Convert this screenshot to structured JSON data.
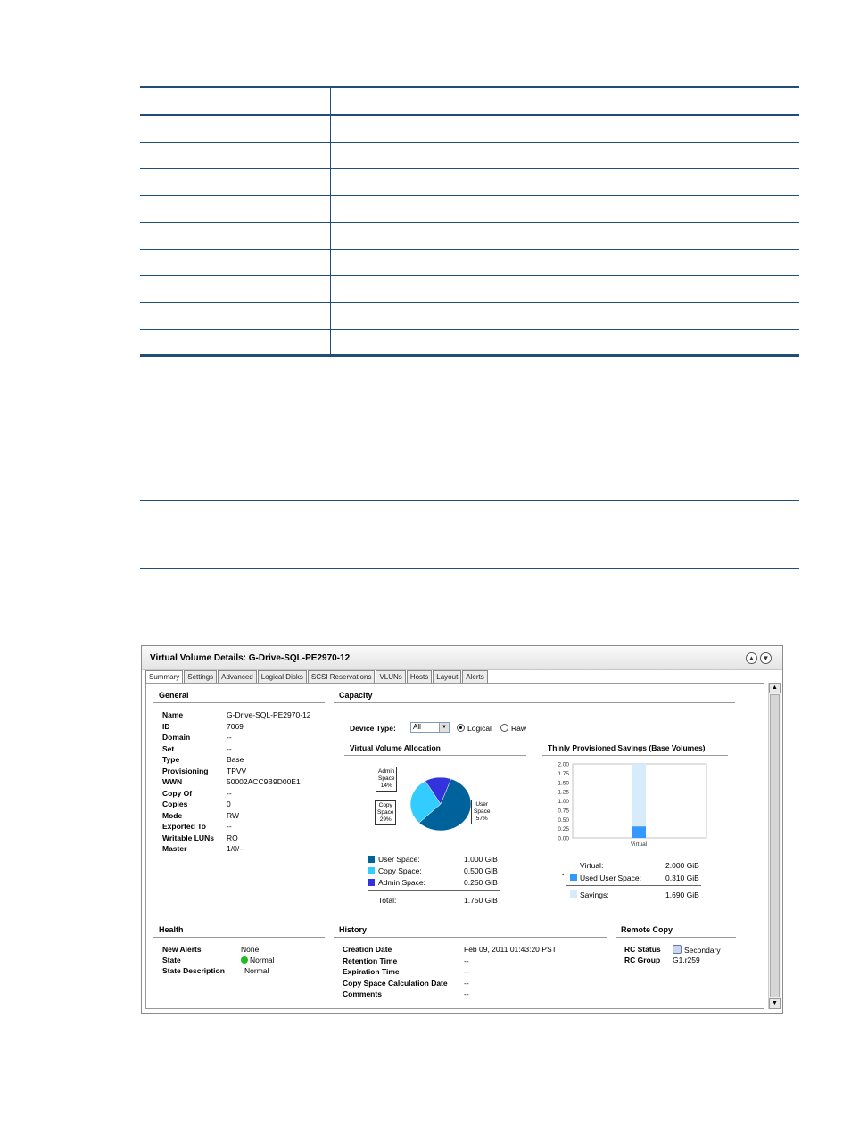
{
  "window": {
    "title": "Virtual Volume Details: G-Drive-SQL-PE2970-12",
    "tabs": [
      "Summary",
      "Settings",
      "Advanced",
      "Logical Disks",
      "SCSI Reservations",
      "VLUNs",
      "Hosts",
      "Layout",
      "Alerts"
    ],
    "active_tab": "Summary"
  },
  "general": {
    "title": "General",
    "fields": [
      {
        "label": "Name",
        "value": "G-Drive-SQL-PE2970-12"
      },
      {
        "label": "ID",
        "value": "7069"
      },
      {
        "label": "Domain",
        "value": "--"
      },
      {
        "label": "Set",
        "value": "--"
      },
      {
        "label": "Type",
        "value": "Base"
      },
      {
        "label": "Provisioning",
        "value": "TPVV"
      },
      {
        "label": "WWN",
        "value": "50002ACC9B9D00E1"
      },
      {
        "label": "Copy Of",
        "value": "--"
      },
      {
        "label": "Copies",
        "value": "0"
      },
      {
        "label": "Mode",
        "value": "RW"
      },
      {
        "label": "Exported To",
        "value": "--"
      },
      {
        "label": "Writable LUNs",
        "value": "RO"
      },
      {
        "label": "Master",
        "value": "1/0/--"
      }
    ]
  },
  "capacity": {
    "title": "Capacity",
    "device_type_label": "Device Type:",
    "device_type_value": "All",
    "radio_logical": "Logical",
    "radio_raw": "Raw",
    "allocation_title": "Virtual Volume Allocation",
    "savings_title": "Thinly Provisioned Savings (Base Volumes)",
    "legend": [
      {
        "label": "User Space:",
        "value": "1.000 GiB",
        "color": "#00629b"
      },
      {
        "label": "Copy Space:",
        "value": "0.500 GiB",
        "color": "#33ccff"
      },
      {
        "label": "Admin Space:",
        "value": "0.250 GiB",
        "color": "#3333dd"
      }
    ],
    "total_label": "Total:",
    "total_value": "1.750 GiB",
    "savings_rows": [
      {
        "label": "Virtual:",
        "value": "2.000 GiB"
      },
      {
        "label": "Used User Space:",
        "value": "0.310 GiB"
      },
      {
        "label": "Savings:",
        "value": "1.690 GiB"
      }
    ]
  },
  "chart_data": [
    {
      "type": "pie",
      "title": "Virtual Volume Allocation",
      "slices": [
        {
          "label": "User Space",
          "percent": 57,
          "color": "#00629b"
        },
        {
          "label": "Copy Space",
          "percent": 29,
          "color": "#33ccff"
        },
        {
          "label": "Admin Space",
          "percent": 14,
          "color": "#3333dd"
        }
      ],
      "callouts": [
        {
          "line1": "User",
          "line2": "Space",
          "line3": "57%"
        },
        {
          "line1": "Copy",
          "line2": "Space",
          "line3": "29%"
        },
        {
          "line1": "Admin",
          "line2": "Space",
          "line3": "14%"
        }
      ]
    },
    {
      "type": "bar",
      "title": "Thinly Provisioned Savings (Base Volumes)",
      "categories": [
        "Virtual"
      ],
      "stack": [
        {
          "name": "Used User Space",
          "value": 0.31,
          "color": "#3399ff"
        },
        {
          "name": "Savings",
          "value": 1.69,
          "color": "#d6ecfb"
        }
      ],
      "yticks": [
        "2.00",
        "1.75",
        "1.50",
        "1.25",
        "1.00",
        "0.75",
        "0.50",
        "0.25",
        "0.00"
      ],
      "ylim": [
        0,
        2
      ]
    }
  ],
  "health": {
    "title": "Health",
    "fields": [
      {
        "label": "New Alerts",
        "value": "None"
      },
      {
        "label": "State",
        "value": "Normal"
      },
      {
        "label": "State Description",
        "value": "Normal"
      }
    ],
    "status_color": "#22bb22"
  },
  "history": {
    "title": "History",
    "fields": [
      {
        "label": "Creation Date",
        "value": "Feb 09, 2011 01:43:20 PST"
      },
      {
        "label": "Retention Time",
        "value": "--"
      },
      {
        "label": "Expiration Time",
        "value": "--"
      },
      {
        "label": "Copy Space Calculation Date",
        "value": "--"
      },
      {
        "label": "Comments",
        "value": "--"
      }
    ]
  },
  "remote_copy": {
    "title": "Remote Copy",
    "fields": [
      {
        "label": "RC Status",
        "value": "Secondary"
      },
      {
        "label": "RC Group",
        "value": "G1.r259"
      }
    ]
  }
}
